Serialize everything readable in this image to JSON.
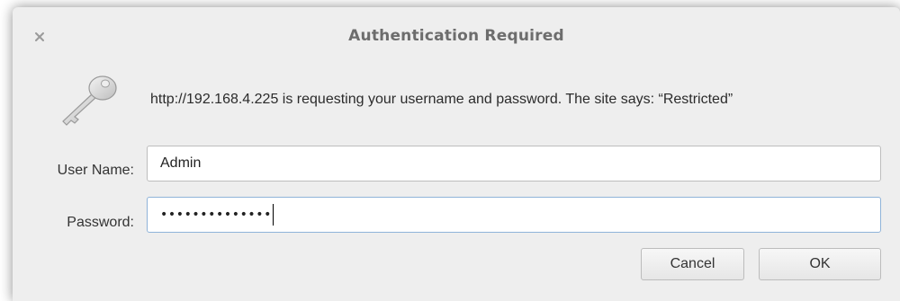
{
  "window": {
    "title": "Authentication Required",
    "close_icon": "close-icon"
  },
  "dialog": {
    "icon": "key-icon",
    "message": "http://192.168.4.225 is requesting your username and password. The site says: “Restricted”"
  },
  "form": {
    "username_label": "User Name:",
    "username_value": "Admin",
    "password_label": "Password:",
    "password_mask": "••••••••••••••"
  },
  "buttons": {
    "cancel_label": "Cancel",
    "ok_label": "OK"
  },
  "colors": {
    "dialog_bg": "#eeeeee",
    "title_text": "#6d6d6d",
    "focus_border": "#8fb3d9"
  }
}
